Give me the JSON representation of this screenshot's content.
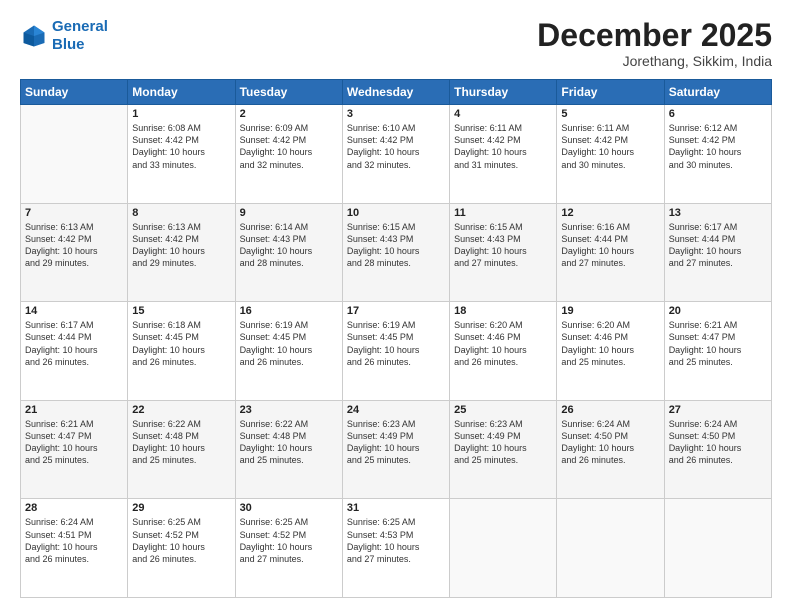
{
  "header": {
    "logo_line1": "General",
    "logo_line2": "Blue",
    "month": "December 2025",
    "location": "Jorethang, Sikkim, India"
  },
  "weekdays": [
    "Sunday",
    "Monday",
    "Tuesday",
    "Wednesday",
    "Thursday",
    "Friday",
    "Saturday"
  ],
  "weeks": [
    [
      {
        "day": "",
        "text": ""
      },
      {
        "day": "1",
        "text": "Sunrise: 6:08 AM\nSunset: 4:42 PM\nDaylight: 10 hours\nand 33 minutes."
      },
      {
        "day": "2",
        "text": "Sunrise: 6:09 AM\nSunset: 4:42 PM\nDaylight: 10 hours\nand 32 minutes."
      },
      {
        "day": "3",
        "text": "Sunrise: 6:10 AM\nSunset: 4:42 PM\nDaylight: 10 hours\nand 32 minutes."
      },
      {
        "day": "4",
        "text": "Sunrise: 6:11 AM\nSunset: 4:42 PM\nDaylight: 10 hours\nand 31 minutes."
      },
      {
        "day": "5",
        "text": "Sunrise: 6:11 AM\nSunset: 4:42 PM\nDaylight: 10 hours\nand 30 minutes."
      },
      {
        "day": "6",
        "text": "Sunrise: 6:12 AM\nSunset: 4:42 PM\nDaylight: 10 hours\nand 30 minutes."
      }
    ],
    [
      {
        "day": "7",
        "text": "Sunrise: 6:13 AM\nSunset: 4:42 PM\nDaylight: 10 hours\nand 29 minutes."
      },
      {
        "day": "8",
        "text": "Sunrise: 6:13 AM\nSunset: 4:42 PM\nDaylight: 10 hours\nand 29 minutes."
      },
      {
        "day": "9",
        "text": "Sunrise: 6:14 AM\nSunset: 4:43 PM\nDaylight: 10 hours\nand 28 minutes."
      },
      {
        "day": "10",
        "text": "Sunrise: 6:15 AM\nSunset: 4:43 PM\nDaylight: 10 hours\nand 28 minutes."
      },
      {
        "day": "11",
        "text": "Sunrise: 6:15 AM\nSunset: 4:43 PM\nDaylight: 10 hours\nand 27 minutes."
      },
      {
        "day": "12",
        "text": "Sunrise: 6:16 AM\nSunset: 4:44 PM\nDaylight: 10 hours\nand 27 minutes."
      },
      {
        "day": "13",
        "text": "Sunrise: 6:17 AM\nSunset: 4:44 PM\nDaylight: 10 hours\nand 27 minutes."
      }
    ],
    [
      {
        "day": "14",
        "text": "Sunrise: 6:17 AM\nSunset: 4:44 PM\nDaylight: 10 hours\nand 26 minutes."
      },
      {
        "day": "15",
        "text": "Sunrise: 6:18 AM\nSunset: 4:45 PM\nDaylight: 10 hours\nand 26 minutes."
      },
      {
        "day": "16",
        "text": "Sunrise: 6:19 AM\nSunset: 4:45 PM\nDaylight: 10 hours\nand 26 minutes."
      },
      {
        "day": "17",
        "text": "Sunrise: 6:19 AM\nSunset: 4:45 PM\nDaylight: 10 hours\nand 26 minutes."
      },
      {
        "day": "18",
        "text": "Sunrise: 6:20 AM\nSunset: 4:46 PM\nDaylight: 10 hours\nand 26 minutes."
      },
      {
        "day": "19",
        "text": "Sunrise: 6:20 AM\nSunset: 4:46 PM\nDaylight: 10 hours\nand 25 minutes."
      },
      {
        "day": "20",
        "text": "Sunrise: 6:21 AM\nSunset: 4:47 PM\nDaylight: 10 hours\nand 25 minutes."
      }
    ],
    [
      {
        "day": "21",
        "text": "Sunrise: 6:21 AM\nSunset: 4:47 PM\nDaylight: 10 hours\nand 25 minutes."
      },
      {
        "day": "22",
        "text": "Sunrise: 6:22 AM\nSunset: 4:48 PM\nDaylight: 10 hours\nand 25 minutes."
      },
      {
        "day": "23",
        "text": "Sunrise: 6:22 AM\nSunset: 4:48 PM\nDaylight: 10 hours\nand 25 minutes."
      },
      {
        "day": "24",
        "text": "Sunrise: 6:23 AM\nSunset: 4:49 PM\nDaylight: 10 hours\nand 25 minutes."
      },
      {
        "day": "25",
        "text": "Sunrise: 6:23 AM\nSunset: 4:49 PM\nDaylight: 10 hours\nand 25 minutes."
      },
      {
        "day": "26",
        "text": "Sunrise: 6:24 AM\nSunset: 4:50 PM\nDaylight: 10 hours\nand 26 minutes."
      },
      {
        "day": "27",
        "text": "Sunrise: 6:24 AM\nSunset: 4:50 PM\nDaylight: 10 hours\nand 26 minutes."
      }
    ],
    [
      {
        "day": "28",
        "text": "Sunrise: 6:24 AM\nSunset: 4:51 PM\nDaylight: 10 hours\nand 26 minutes."
      },
      {
        "day": "29",
        "text": "Sunrise: 6:25 AM\nSunset: 4:52 PM\nDaylight: 10 hours\nand 26 minutes."
      },
      {
        "day": "30",
        "text": "Sunrise: 6:25 AM\nSunset: 4:52 PM\nDaylight: 10 hours\nand 27 minutes."
      },
      {
        "day": "31",
        "text": "Sunrise: 6:25 AM\nSunset: 4:53 PM\nDaylight: 10 hours\nand 27 minutes."
      },
      {
        "day": "",
        "text": ""
      },
      {
        "day": "",
        "text": ""
      },
      {
        "day": "",
        "text": ""
      }
    ]
  ]
}
